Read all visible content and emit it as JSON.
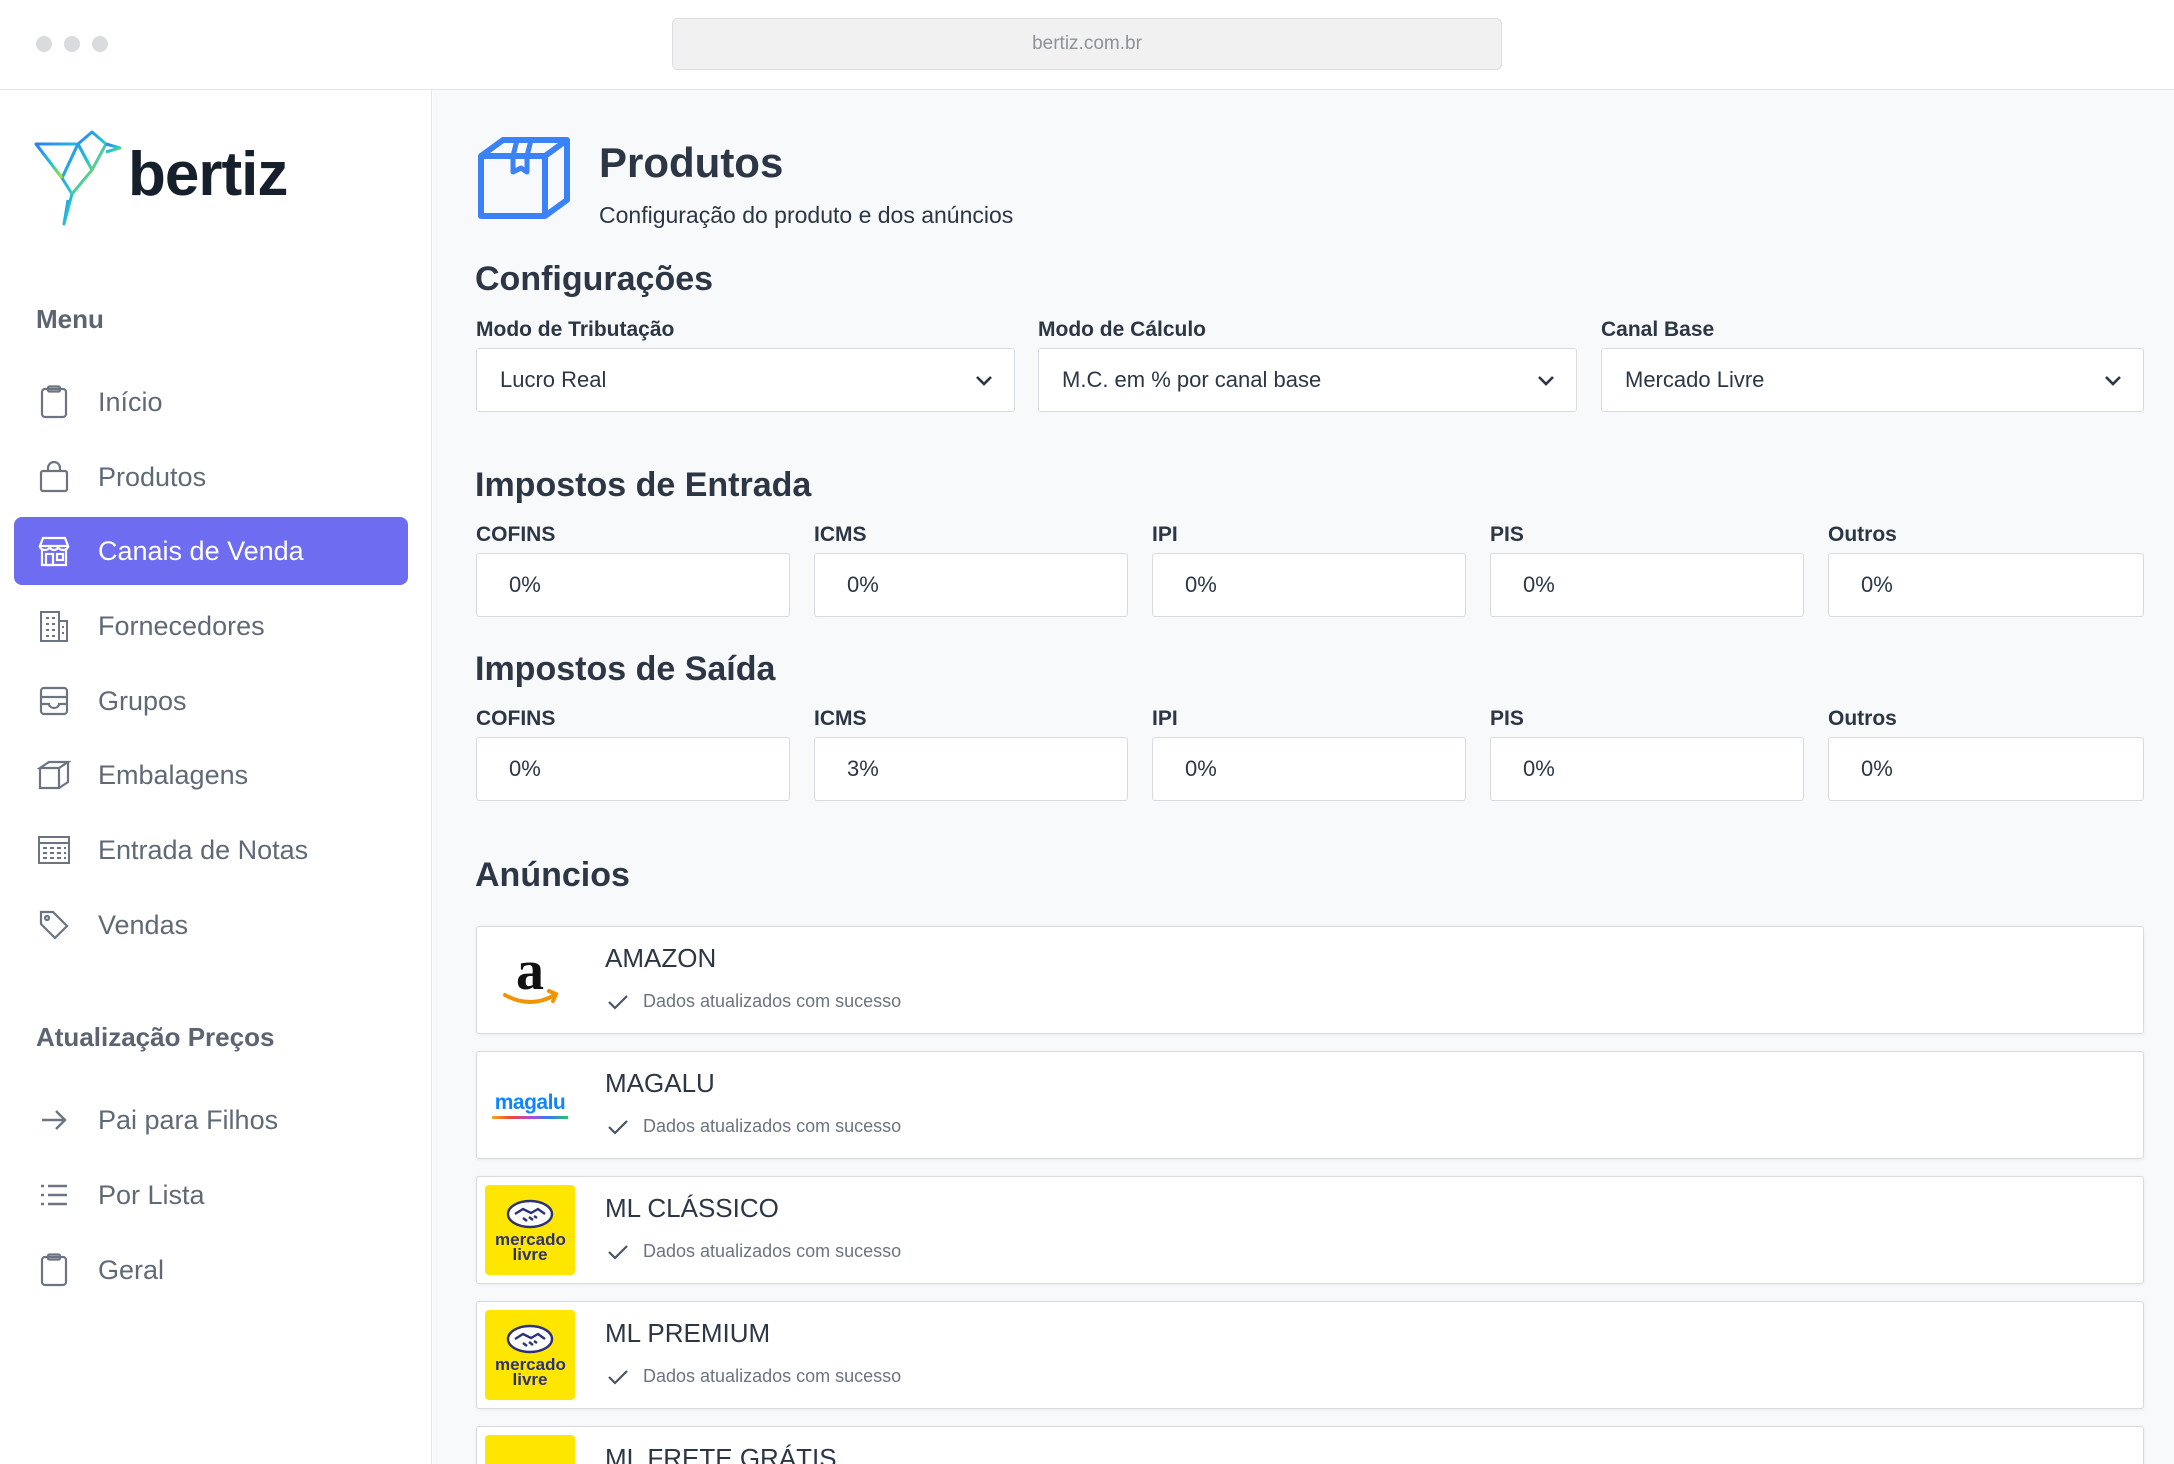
{
  "browser": {
    "url": "bertiz.com.br"
  },
  "brand": {
    "name": "bertiz"
  },
  "sidebar": {
    "menu_title": "Menu",
    "items": [
      {
        "label": "Início",
        "icon": "clipboard-icon"
      },
      {
        "label": "Produtos",
        "icon": "shopping-bag-icon"
      },
      {
        "label": "Canais de Venda",
        "icon": "storefront-icon",
        "active": true
      },
      {
        "label": "Fornecedores",
        "icon": "building-icon"
      },
      {
        "label": "Grupos",
        "icon": "inbox-icon"
      },
      {
        "label": "Embalagens",
        "icon": "package-icon"
      },
      {
        "label": "Entrada de Notas",
        "icon": "invoice-grid-icon"
      },
      {
        "label": "Vendas",
        "icon": "tag-icon"
      }
    ],
    "price_title": "Atualização Preços",
    "price_items": [
      {
        "label": "Pai para Filhos",
        "icon": "arrow-right-icon"
      },
      {
        "label": "Por Lista",
        "icon": "list-icon"
      },
      {
        "label": "Geral",
        "icon": "clipboard-icon"
      }
    ]
  },
  "header": {
    "title": "Produtos",
    "subtitle": "Configuração do produto e dos anúncios"
  },
  "config": {
    "title": "Configurações",
    "fields": [
      {
        "label": "Modo de Tributação",
        "value": "Lucro Real"
      },
      {
        "label": "Modo de Cálculo",
        "value": "M.C. em % por canal base"
      },
      {
        "label": "Canal Base",
        "value": "Mercado Livre"
      }
    ]
  },
  "taxes_in": {
    "title": "Impostos de Entrada",
    "fields": [
      {
        "label": "COFINS",
        "value": "0%"
      },
      {
        "label": "ICMS",
        "value": "0%"
      },
      {
        "label": "IPI",
        "value": "0%"
      },
      {
        "label": "PIS",
        "value": "0%"
      },
      {
        "label": "Outros",
        "value": "0%"
      }
    ]
  },
  "taxes_out": {
    "title": "Impostos de Saída",
    "fields": [
      {
        "label": "COFINS",
        "value": "0%"
      },
      {
        "label": "ICMS",
        "value": "3%"
      },
      {
        "label": "IPI",
        "value": "0%"
      },
      {
        "label": "PIS",
        "value": "0%"
      },
      {
        "label": "Outros",
        "value": "0%"
      }
    ]
  },
  "ads": {
    "title": "Anúncios",
    "channels": [
      {
        "name": "AMAZON",
        "status": "Dados atualizados com sucesso"
      },
      {
        "name": "MAGALU",
        "status": "Dados atualizados com sucesso",
        "logo_text": "magalu"
      },
      {
        "name": "ML CLÁSSICO",
        "status": "Dados atualizados com sucesso",
        "logo_text": "mercado livre"
      },
      {
        "name": "ML PREMIUM",
        "status": "Dados atualizados com sucesso",
        "logo_text": "mercado livre"
      },
      {
        "name": "ML FRETE GRÁTIS"
      }
    ]
  },
  "colors": {
    "accent": "#6e6cf0",
    "ml_yellow": "#ffe600",
    "icon_blue": "#3b82f6"
  }
}
